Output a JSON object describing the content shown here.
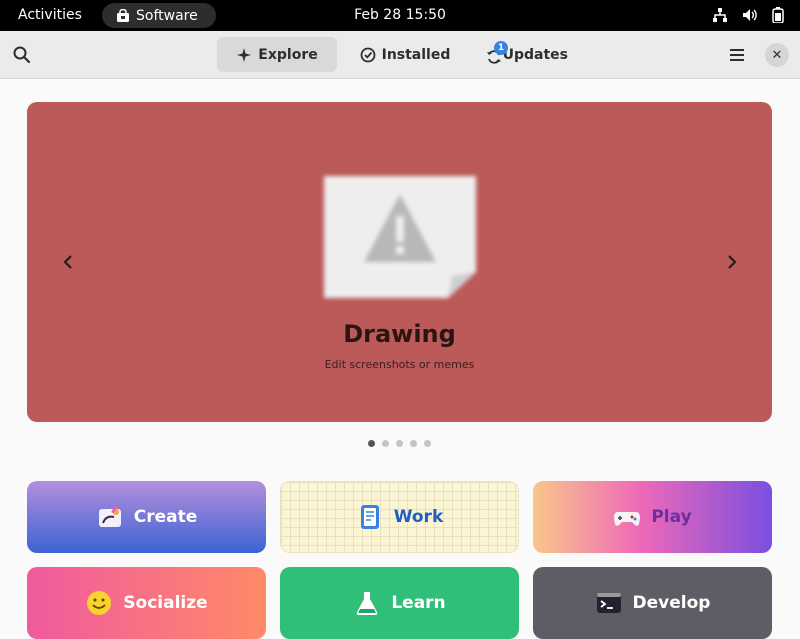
{
  "topbar": {
    "activities": "Activities",
    "app_name": "Software",
    "clock": "Feb 28  15:50"
  },
  "header": {
    "tabs": [
      {
        "label": "Explore",
        "active": true,
        "icon": "sparkle-icon"
      },
      {
        "label": "Installed",
        "active": false,
        "icon": "check-circle-icon"
      },
      {
        "label": "Updates",
        "active": false,
        "icon": "refresh-icon",
        "badge": "1"
      }
    ]
  },
  "carousel": {
    "title": "Drawing",
    "subtitle": "Edit screenshots or memes",
    "background": "#bc5959",
    "page_count": 5,
    "current_page": 1
  },
  "categories": [
    {
      "label": "Create",
      "icon": "palette-icon"
    },
    {
      "label": "Work",
      "icon": "clipboard-icon"
    },
    {
      "label": "Play",
      "icon": "gamepad-icon"
    },
    {
      "label": "Socialize",
      "icon": "smiley-icon"
    },
    {
      "label": "Learn",
      "icon": "flask-icon"
    },
    {
      "label": "Develop",
      "icon": "terminal-icon"
    }
  ],
  "colors": {
    "accent": "#3584e4",
    "topbar": "#000000",
    "headerbar": "#ebebeb"
  }
}
